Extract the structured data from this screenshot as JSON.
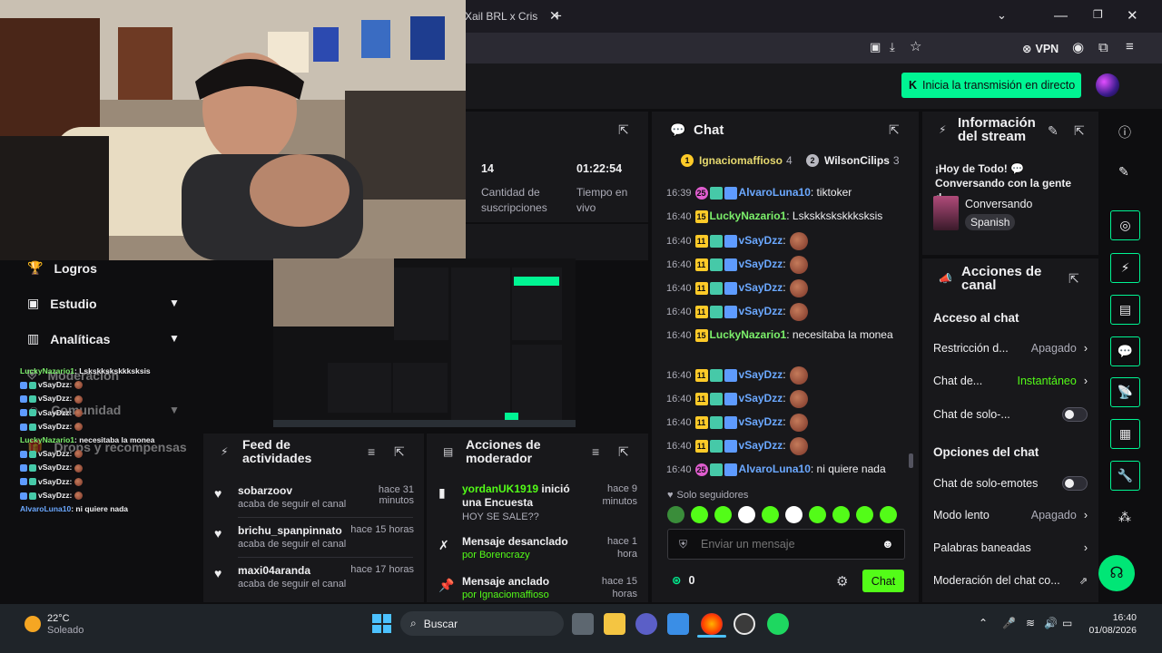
{
  "browser": {
    "tab_title": "Xail BRL x Cris M",
    "new_tab": "+",
    "vpn_label": "VPN"
  },
  "header": {
    "go_live_label": "Inicia la transmisión en directo"
  },
  "stats": {
    "subs_value": "14",
    "subs_label": "Cantidad de suscripciones",
    "time_value": "01:22:54",
    "time_label": "Tiempo en vivo"
  },
  "sidebar": {
    "items": [
      {
        "label": "Logros"
      },
      {
        "label": "Estudio"
      },
      {
        "label": "Analíticas"
      },
      {
        "label": "Moderación"
      },
      {
        "label": "Comunidad"
      },
      {
        "label": "Drops y recompensas"
      }
    ]
  },
  "overlay_chat": [
    {
      "user": "LuckyNazario1",
      "text": ": Lskskkskskkksksis"
    },
    {
      "user": "vSayDzz",
      "text": ":"
    },
    {
      "user": "vSayDzz",
      "text": ":"
    },
    {
      "user": "vSayDzz",
      "text": ":"
    },
    {
      "user": "vSayDzz",
      "text": ":"
    },
    {
      "user": "LuckyNazario1",
      "text": ": necesitaba la monea"
    },
    {
      "user": "vSayDzz",
      "text": ":"
    },
    {
      "user": "vSayDzz",
      "text": ":"
    },
    {
      "user": "vSayDzz",
      "text": ":"
    },
    {
      "user": "vSayDzz",
      "text": ":"
    },
    {
      "user": "AlvaroLuna10",
      "text": ": ni quiere nada"
    }
  ],
  "feed": {
    "title": "Feed de actividades",
    "items": [
      {
        "user": "sobarzoov",
        "time": "hace 31 minutos",
        "action": "acaba de seguir el canal"
      },
      {
        "user": "brichu_spanpinnato",
        "time": "hace 15 horas",
        "action": "acaba de seguir el canal"
      },
      {
        "user": "maxi04aranda",
        "time": "hace 17 horas",
        "action": "acaba de seguir el canal"
      }
    ]
  },
  "mod_actions": {
    "title": "Acciones de moderador",
    "items": [
      {
        "user": "yordanUK1919",
        "text": " inició una Encuesta",
        "time": "hace 9 minutos",
        "sub": "HOY SE SALE??"
      },
      {
        "user": "",
        "text": "Mensaje desanclado",
        "time": "hace 1 hora",
        "sub": "por Borencrazy"
      },
      {
        "user": "",
        "text": "Mensaje anclado",
        "time": "hace 15 horas",
        "sub": "por Ignaciomaffioso"
      }
    ]
  },
  "chat": {
    "title": "Chat",
    "top_gifters": [
      {
        "name": "Ignaciomaffioso",
        "count": "4"
      },
      {
        "name": "WilsonCilips",
        "count": "3"
      }
    ],
    "messages": [
      {
        "time": "16:39",
        "badge": "25",
        "user": "AlvaroLuna10",
        "text": ": tiktoker"
      },
      {
        "time": "16:40",
        "badge": "15",
        "user": "LuckyNazario1",
        "text": ": Lskskkskskkksksis"
      },
      {
        "time": "16:40",
        "badge": "11",
        "user": "vSayDzz",
        "text": ":"
      },
      {
        "time": "16:40",
        "badge": "11",
        "user": "vSayDzz",
        "text": ":"
      },
      {
        "time": "16:40",
        "badge": "11",
        "user": "vSayDzz",
        "text": ":"
      },
      {
        "time": "16:40",
        "badge": "11",
        "user": "vSayDzz",
        "text": ":"
      },
      {
        "time": "16:40",
        "badge": "15",
        "user": "LuckyNazario1",
        "text": ": necesitaba la monea"
      },
      {
        "time": "16:40",
        "badge": "11",
        "user": "vSayDzz",
        "text": ":"
      },
      {
        "time": "16:40",
        "badge": "11",
        "user": "vSayDzz",
        "text": ":"
      },
      {
        "time": "16:40",
        "badge": "11",
        "user": "vSayDzz",
        "text": ":"
      },
      {
        "time": "16:40",
        "badge": "11",
        "user": "vSayDzz",
        "text": ":"
      },
      {
        "time": "16:40",
        "badge": "25",
        "user": "AlvaroLuna10",
        "text": ": ni quiere nada"
      }
    ],
    "followers_only": "Solo seguidores",
    "input_placeholder": "Enviar un mensaje",
    "points": "0",
    "send_label": "Chat"
  },
  "stream_info": {
    "title": "Información del stream",
    "stream_title": "¡Hoy de Todo! 💬 Conversando con la gente d...",
    "category": "Conversando",
    "language": "Spanish"
  },
  "channel_actions": {
    "title": "Acciones de canal",
    "chat_access_heading": "Acceso al chat",
    "restriction_label": "Restricción d...",
    "restriction_value": "Apagado",
    "chat_de_label": "Chat de...",
    "chat_de_value": "Instantáneo",
    "solo_label": "Chat de solo-...",
    "chat_options_heading": "Opciones del chat",
    "emotes_label": "Chat de solo-emotes",
    "slow_label": "Modo lento",
    "slow_value": "Apagado",
    "banned_label": "Palabras baneadas",
    "moderation_label": "Moderación del chat co..."
  },
  "taskbar": {
    "weather_temp": "22°C",
    "weather_desc": "Soleado",
    "search_label": "Buscar",
    "clock_time": "16:40",
    "clock_date": "01/08/2026"
  },
  "colors": {
    "kick_green": "#00f593",
    "user_blue": "#6ba8ff",
    "user_green": "#7cf06b"
  }
}
